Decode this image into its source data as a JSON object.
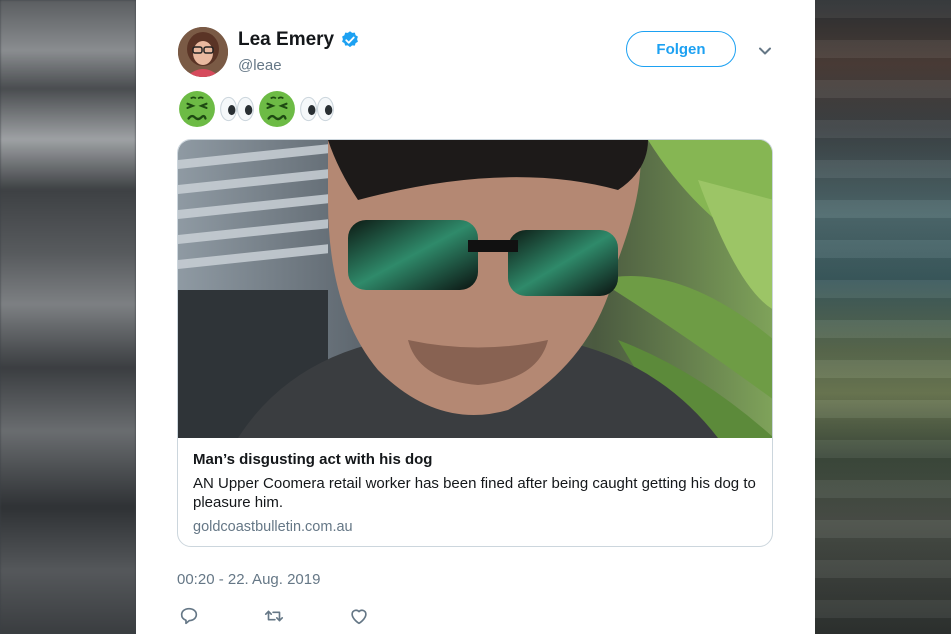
{
  "tweet": {
    "author_name": "Lea Emery",
    "author_handle": "@leae",
    "verified_icon": "verified-badge-icon",
    "follow_label": "Folgen",
    "emoji_sequence": [
      "nauseated-face",
      "eyes",
      "nauseated-face",
      "eyes"
    ],
    "timestamp": "00:20 - 22. Aug. 2019"
  },
  "link_card": {
    "title": "Man’s disgusting act with his dog",
    "description": "AN Upper Coomera retail worker has been fined after being caught getting his dog to pleasure him.",
    "domain": "goldcoastbulletin.com.au"
  },
  "actions": [
    "reply-icon",
    "retweet-icon",
    "like-icon"
  ],
  "colors": {
    "accent": "#1da1f2",
    "text_primary": "#14171a",
    "text_secondary": "#657786",
    "border": "#ccd6dd"
  }
}
